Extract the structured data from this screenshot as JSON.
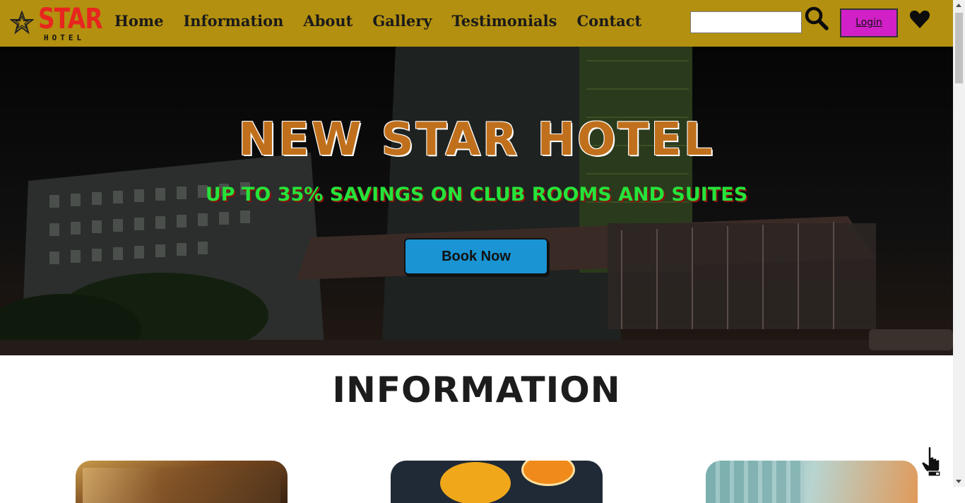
{
  "navbar": {
    "logo": {
      "word": "STAR",
      "subtitle": "HOTEL"
    },
    "links": [
      "Home",
      "Information",
      "About",
      "Gallery",
      "Testimonials",
      "Contact"
    ],
    "search": {
      "value": "",
      "placeholder": ""
    },
    "login_label": "Login",
    "icons": {
      "search": "search-icon",
      "favorites": "heart-icon"
    }
  },
  "hero": {
    "title": "NEW STAR HOTEL",
    "subtitle": "UP TO 35% SAVINGS ON CLUB ROOMS AND SUITES",
    "button_label": "Book Now"
  },
  "information": {
    "title": "INFORMATION",
    "cards": [
      "room-image",
      "juice-image",
      "lobby-image"
    ]
  },
  "colors": {
    "nav_bg": "#b3900f",
    "logo_red": "#e8251f",
    "title_orange": "#c0701c",
    "subtitle_green": "#25e33a",
    "button_blue": "#1a94d3",
    "login_magenta": "#d220c8"
  }
}
